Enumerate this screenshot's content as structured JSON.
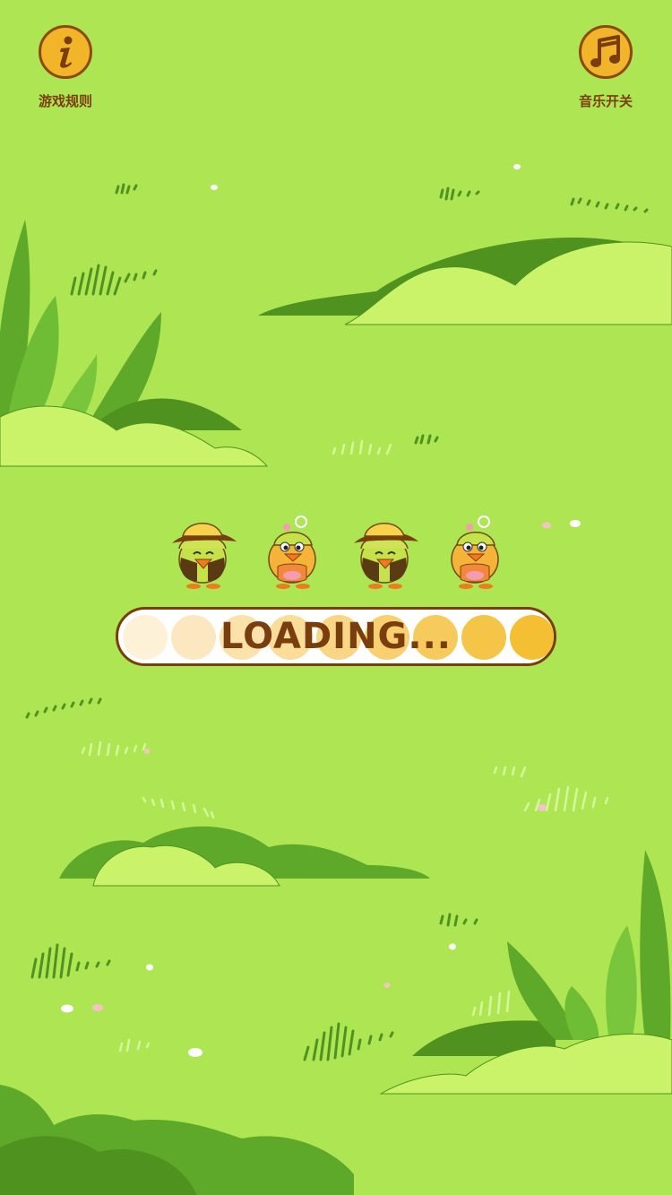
{
  "top_bar": {
    "rules_label": "游戏规则",
    "music_label": "音乐开关"
  },
  "loading": {
    "text": "LOADING...",
    "dot_count": 9,
    "dot_colors": [
      "#fdf1d8",
      "#fbe8c0",
      "#fbe2aa",
      "#fadd98",
      "#f9d685",
      "#f8d070",
      "#f7ca5c",
      "#f5c548",
      "#f4bf32"
    ]
  },
  "characters": [
    {
      "name": "duck-explorer-1",
      "type": "explorer"
    },
    {
      "name": "duck-girl-1",
      "type": "girl"
    },
    {
      "name": "duck-explorer-2",
      "type": "explorer"
    },
    {
      "name": "duck-girl-2",
      "type": "girl"
    }
  ],
  "colors": {
    "background": "#aee552",
    "button_fill": "#f2b52a",
    "button_border": "#8a4a12",
    "text_brown": "#7a3d0e"
  }
}
